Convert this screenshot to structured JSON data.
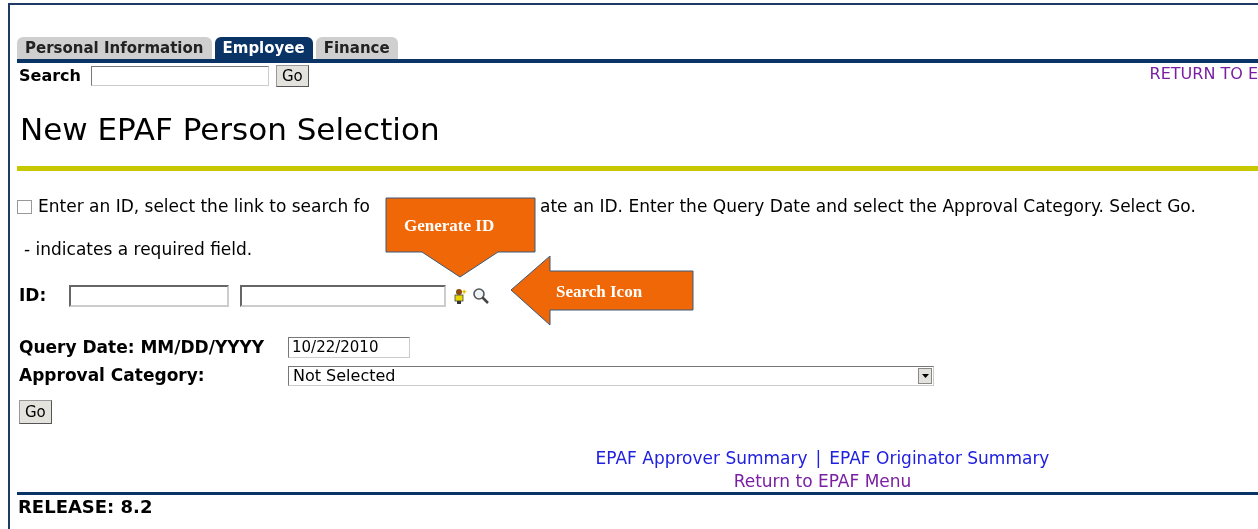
{
  "tabs": [
    {
      "label": "Personal Information",
      "selected": false
    },
    {
      "label": "Employee",
      "selected": true
    },
    {
      "label": "Finance",
      "selected": false
    }
  ],
  "search": {
    "label": "Search",
    "button": "Go"
  },
  "return_link": "RETURN TO E",
  "title": "New EPAF Person Selection",
  "instructions": {
    "checked": false,
    "before": "Enter an ID, select the link to search fo",
    "after": "ate an ID. Enter the Query Date and select the Approval Category. Select Go."
  },
  "required_note": "- indicates a required field.",
  "id_label": "ID:",
  "query_date": {
    "label": "Query Date: MM/DD/YYYY",
    "value": "10/22/2010"
  },
  "approval_category": {
    "label": "Approval Category:",
    "value": "Not Selected"
  },
  "go_button": "Go",
  "callouts": [
    {
      "kind": "down",
      "label": "Generate ID"
    },
    {
      "kind": "left",
      "label": "Search Icon"
    }
  ],
  "summary_links": [
    "EPAF Approver Summary",
    "EPAF Originator Summary"
  ],
  "summary_separator": "|",
  "return_menu": "Return to EPAF Menu",
  "release": "RELEASE: 8.2"
}
